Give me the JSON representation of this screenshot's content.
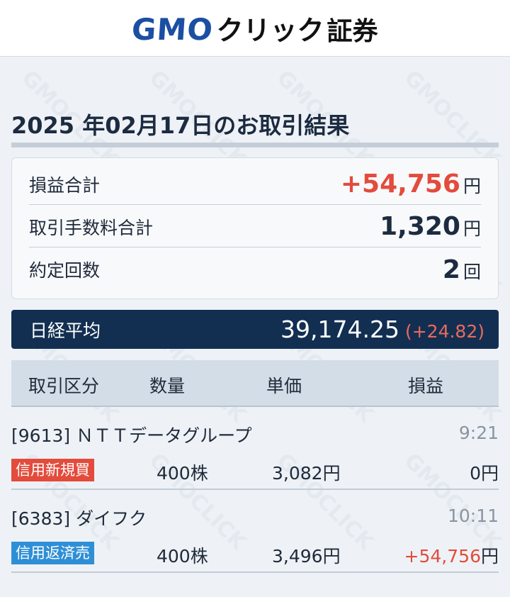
{
  "header": {
    "logo_gmo": "GMO",
    "logo_click": "クリック",
    "logo_sho": "証券"
  },
  "watermark": "GMOCLICK",
  "title": "2025 年02月17日のお取引結果",
  "summary": {
    "profit_label": "損益合計",
    "profit_value": "+54,756",
    "profit_unit": "円",
    "fee_label": "取引手数料合計",
    "fee_value": "1,320",
    "fee_unit": "円",
    "count_label": "約定回数",
    "count_value": "2",
    "count_unit": "回"
  },
  "nikkei": {
    "label": "日経平均",
    "value": "39,174.25",
    "change": "(+24.82)"
  },
  "table": {
    "headers": [
      "取引区分",
      "数量",
      "単価",
      "損益"
    ]
  },
  "trades": [
    {
      "stock": "[9613] ＮＴＴデータグループ",
      "time": "9:21",
      "type": "信用新規買",
      "qty": "400",
      "qty_unit": "株",
      "price": "3,082",
      "price_unit": "円",
      "pl": "0",
      "pl_unit": "円"
    },
    {
      "stock": "[6383] ダイフク",
      "time": "10:11",
      "type": "信用返済売",
      "qty": "400",
      "qty_unit": "株",
      "price": "3,496",
      "price_unit": "円",
      "pl": "+54,756",
      "pl_unit": "円"
    }
  ],
  "colors": {
    "accent_red": "#e34b3c",
    "nikkei_bg": "#122f52",
    "badge_blue": "#2f8fd6",
    "logo_blue": "#1b4fa3"
  }
}
